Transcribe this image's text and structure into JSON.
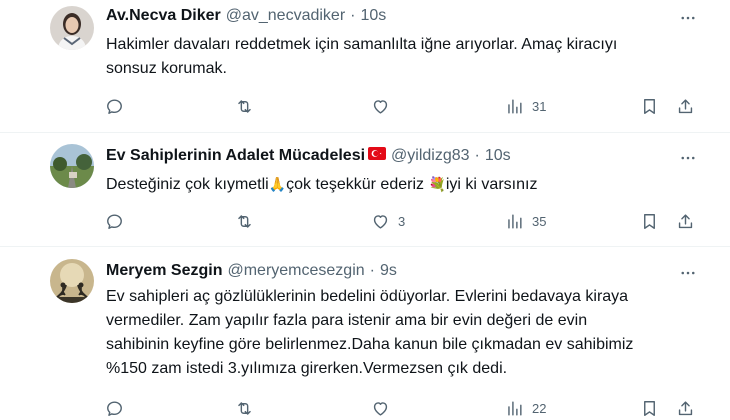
{
  "tweets": [
    {
      "name": "Av.Necva Diker",
      "handle": "@av_necvadiker",
      "sep": "·",
      "time": "10s",
      "text_lines": [
        "Hakimler davaları reddetmek için samanlılta iğne arıyorlar. Amaç kiracıyı",
        "sonsuz korumak."
      ],
      "reply_count": "",
      "retweet_count": "",
      "like_count": "",
      "view_count": "31"
    },
    {
      "name": "Ev Sahiplerinin Adalet Mücadelesi",
      "flag_emoji": "🇹🇷",
      "handle": "@yildizg83",
      "sep": "·",
      "time": "10s",
      "text_parts": [
        "Desteğiniz çok kıymetli",
        "🙏",
        "çok teşekkür ederiz ",
        "💐",
        "iyi ki varsınız"
      ],
      "reply_count": "",
      "retweet_count": "",
      "like_count": "3",
      "view_count": "35"
    },
    {
      "name": "Meryem Sezgin",
      "handle": "@meryemcesezgin",
      "sep": "·",
      "time": "9s",
      "text_lines": [
        "Ev sahipleri aç gözlülüklerinin bedelini ödüyorlar. Evlerini bedavaya kiraya",
        "vermediler. Zam yapılır fazla para istenir ama bir evin değeri de evin",
        "sahibinin keyfine göre belirlenmez.Daha kanun bile çıkmadan ev sahibimiz",
        "%150 zam istedi 3.yılımıza girerken.Vermezsen çık dedi."
      ],
      "reply_count": "",
      "retweet_count": "",
      "like_count": "",
      "view_count": "22"
    }
  ],
  "icons": {
    "reply": "reply-icon",
    "retweet": "retweet-icon",
    "like": "heart-icon",
    "views": "views-icon",
    "bookmark": "bookmark-icon",
    "share": "share-icon",
    "more": "more-icon"
  },
  "colors": {
    "text": "#0f1419",
    "secondary": "#536471",
    "divider": "#eff3f4"
  }
}
